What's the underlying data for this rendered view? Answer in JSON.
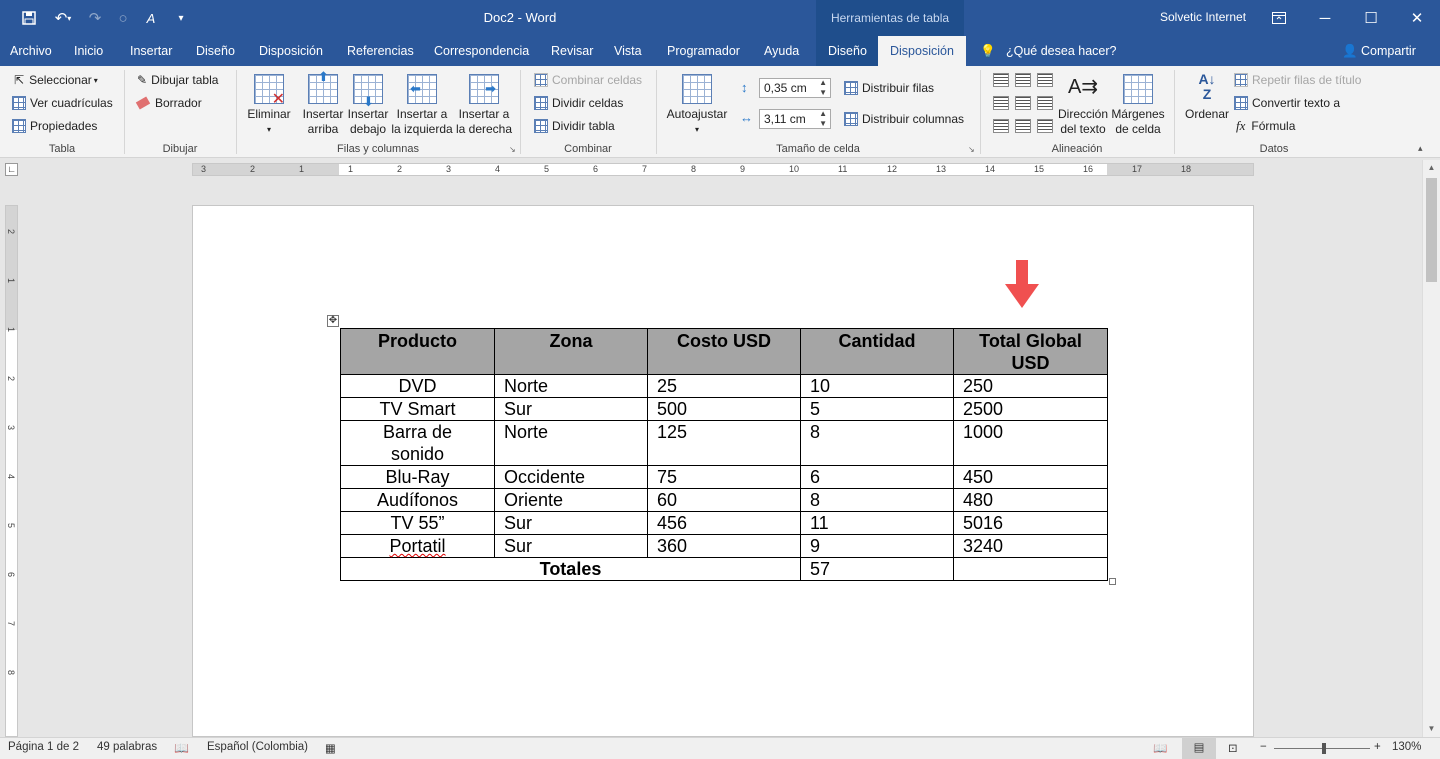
{
  "titlebar": {
    "doc_title": "Doc2 - Word",
    "context_title": "Herramientas de tabla",
    "user": "Solvetic Internet"
  },
  "tabs": [
    {
      "label": "Archivo"
    },
    {
      "label": "Inicio"
    },
    {
      "label": "Insertar"
    },
    {
      "label": "Diseño"
    },
    {
      "label": "Disposición"
    },
    {
      "label": "Referencias"
    },
    {
      "label": "Correspondencia"
    },
    {
      "label": "Revisar"
    },
    {
      "label": "Vista"
    },
    {
      "label": "Programador"
    },
    {
      "label": "Ayuda"
    },
    {
      "label": "Diseño"
    },
    {
      "label": "Disposición"
    }
  ],
  "tell_me": "¿Qué desea hacer?",
  "share": "Compartir",
  "ribbon": {
    "tabla": {
      "label": "Tabla",
      "seleccionar": "Seleccionar",
      "ver_cuadriculas": "Ver cuadrículas",
      "propiedades": "Propiedades"
    },
    "dibujar": {
      "label": "Dibujar",
      "dibujar_tabla": "Dibujar tabla",
      "borrador": "Borrador"
    },
    "filas": {
      "label": "Filas y columnas",
      "eliminar": "Eliminar",
      "insertar_arriba_1": "Insertar",
      "insertar_arriba_2": "arriba",
      "insertar_debajo_1": "Insertar",
      "insertar_debajo_2": "debajo",
      "insertar_izq_1": "Insertar a",
      "insertar_izq_2": "la izquierda",
      "insertar_der_1": "Insertar a",
      "insertar_der_2": "la derecha"
    },
    "combinar": {
      "label": "Combinar",
      "combinar_celdas": "Combinar celdas",
      "dividir_celdas": "Dividir celdas",
      "dividir_tabla": "Dividir tabla"
    },
    "tamano": {
      "label": "Tamaño de celda",
      "autoajustar": "Autoajustar",
      "height": "0,35 cm",
      "width": "3,11 cm",
      "distribuir_filas": "Distribuir filas",
      "distribuir_columnas": "Distribuir columnas"
    },
    "alineacion": {
      "label": "Alineación",
      "direccion_1": "Dirección",
      "direccion_2": "del texto",
      "margenes_1": "Márgenes",
      "margenes_2": "de celda"
    },
    "datos": {
      "label": "Datos",
      "ordenar": "Ordenar",
      "repetir": "Repetir filas de título",
      "convertir": "Convertir texto a",
      "formula": "Fórmula"
    }
  },
  "ruler": {
    "labels": [
      "3",
      "2",
      "1",
      "1",
      "2",
      "3",
      "4",
      "5",
      "6",
      "7",
      "8",
      "9",
      "10",
      "11",
      "12",
      "13",
      "14",
      "15",
      "16",
      "17",
      "18"
    ],
    "vlabels": [
      "2",
      "1",
      "1",
      "2",
      "3",
      "4",
      "5",
      "6",
      "7",
      "8"
    ]
  },
  "table": {
    "headers": [
      "Producto",
      "Zona",
      "Costo USD",
      "Cantidad",
      "Total Global USD"
    ],
    "rows": [
      [
        "DVD",
        "Norte",
        "25",
        "10",
        "250"
      ],
      [
        "TV Smart",
        "Sur",
        "500",
        "5",
        "2500"
      ],
      [
        "Barra de sonido",
        "Norte",
        "125",
        "8",
        "1000"
      ],
      [
        "Blu-Ray",
        "Occidente",
        "75",
        "6",
        "450"
      ],
      [
        "Audífonos",
        "Oriente",
        "60",
        "8",
        "480"
      ],
      [
        "TV 55”",
        "Sur",
        "456",
        "11",
        "5016"
      ],
      [
        "Portatil",
        "Sur",
        "360",
        "9",
        "3240"
      ]
    ],
    "totals_label": "Totales",
    "totals_qty": "57",
    "totals_global": ""
  },
  "status": {
    "page": "Página 1 de 2",
    "words": "49 palabras",
    "language": "Español (Colombia)",
    "zoom": "130%",
    "zoom_level": 0.52
  },
  "colors": {
    "accent": "#2b579a",
    "context_band": "#1f4e8c",
    "header_fill": "#a5a5a5",
    "arrow": "#f05050"
  }
}
